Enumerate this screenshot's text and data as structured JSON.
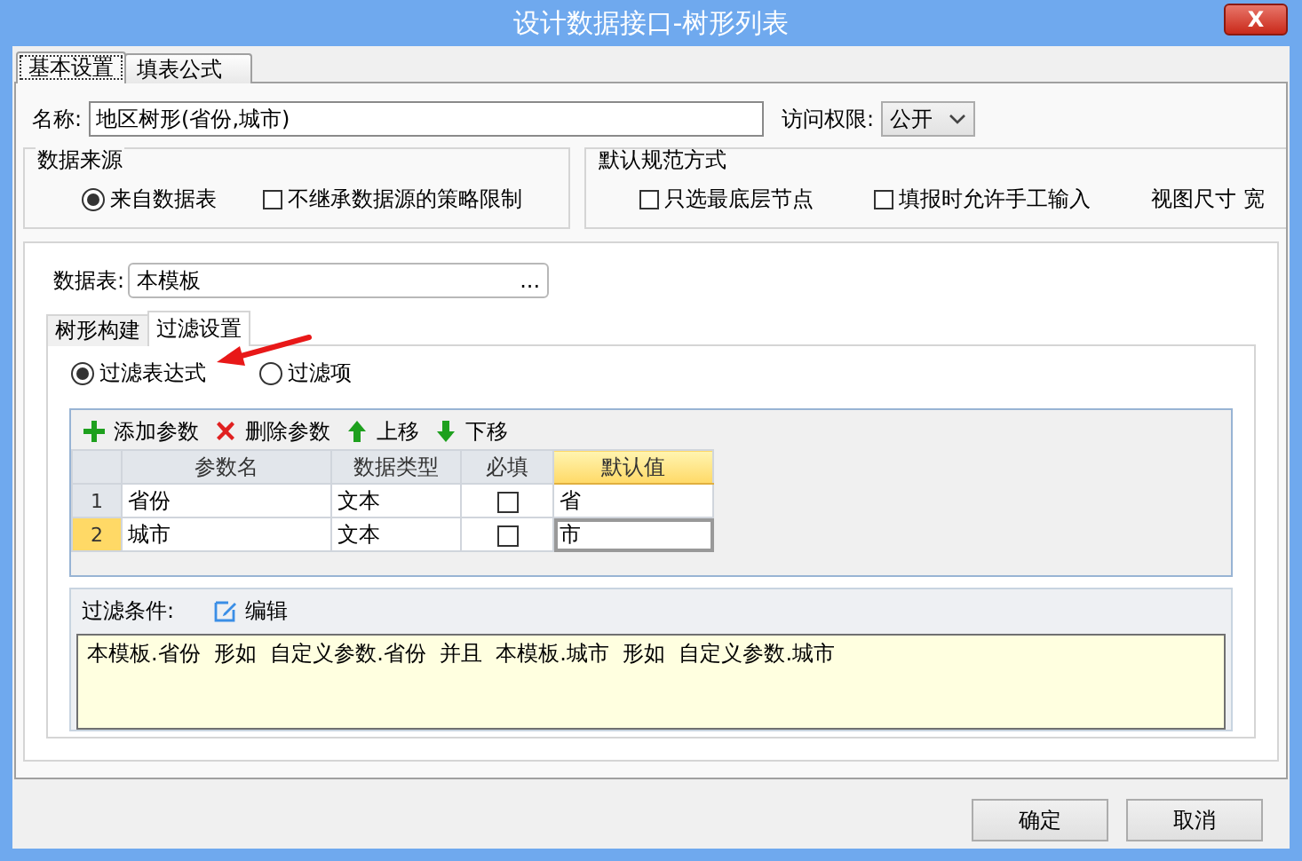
{
  "window": {
    "title": "设计数据接口-树形列表",
    "close": "X"
  },
  "tabs": [
    {
      "label": "基本设置",
      "selected": true
    },
    {
      "label": "填表公式",
      "selected": false
    }
  ],
  "name_field": {
    "label": "名称:",
    "value": "地区树形(省份,城市)"
  },
  "access": {
    "label": "访问权限:",
    "value": "公开"
  },
  "data_source": {
    "title": "数据来源",
    "options": [
      {
        "kind": "radio",
        "label": "来自数据表",
        "checked": true
      },
      {
        "kind": "checkbox",
        "label": "不继承数据源的策略限制",
        "checked": false
      }
    ]
  },
  "default_mode": {
    "title": "默认规范方式",
    "options": [
      {
        "kind": "checkbox",
        "label": "只选最底层节点",
        "checked": false
      },
      {
        "kind": "checkbox",
        "label": "填报时允许手工输入",
        "checked": false
      },
      {
        "kind": "text",
        "label": "视图尺寸 宽"
      }
    ]
  },
  "data_table": {
    "label": "数据表:",
    "value": "本模板",
    "button": "..."
  },
  "inner_tabs": [
    {
      "label": "树形构建",
      "selected": false
    },
    {
      "label": "过滤设置",
      "selected": true
    }
  ],
  "filter_mode": [
    {
      "label": "过滤表达式",
      "selected": true
    },
    {
      "label": "过滤项",
      "selected": false
    }
  ],
  "toolbar": [
    {
      "kind": "add",
      "label": "添加参数"
    },
    {
      "kind": "delete",
      "label": "删除参数"
    },
    {
      "kind": "up",
      "label": "上移"
    },
    {
      "kind": "down",
      "label": "下移"
    }
  ],
  "grid": {
    "columns": [
      {
        "label": "参数名",
        "selected": false
      },
      {
        "label": "数据类型",
        "selected": false
      },
      {
        "label": "必填",
        "selected": false
      },
      {
        "label": "默认值",
        "selected": true
      }
    ],
    "rows": [
      {
        "index": "1",
        "name": "省份",
        "type": "文本",
        "required": false,
        "default": "省",
        "selected": false
      },
      {
        "index": "2",
        "name": "城市",
        "type": "文本",
        "required": false,
        "default": "市",
        "selected": true
      }
    ]
  },
  "condition": {
    "label": "过滤条件:",
    "edit": "编辑",
    "text": "本模板.省份  形如  自定义参数.省份  并且  本模板.城市  形如  自定义参数.城市"
  },
  "buttons": [
    "确定",
    "取消"
  ]
}
